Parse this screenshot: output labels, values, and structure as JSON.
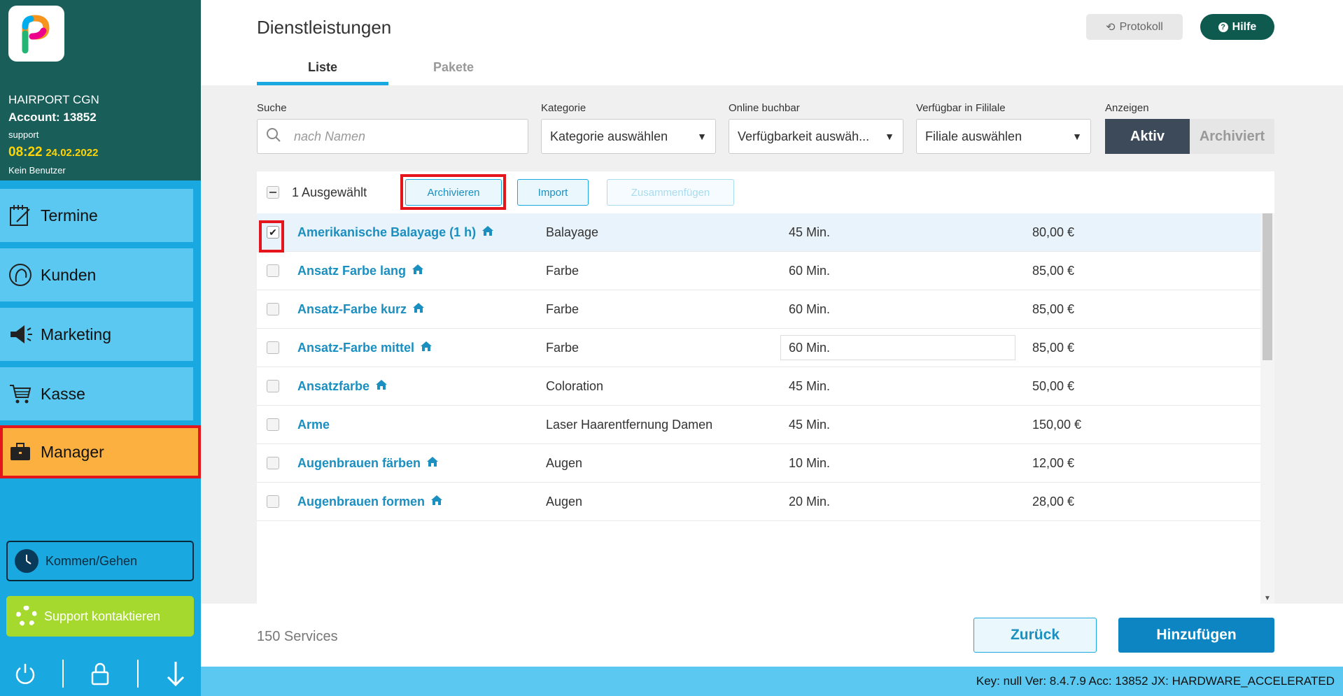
{
  "sidebar": {
    "account_name": "HAIRPORT CGN",
    "account_label": "Account: 13852",
    "user": "support",
    "time": "08:22",
    "date": "24.02.2022",
    "user_status": "Kein Benutzer",
    "nav": [
      {
        "label": "Termine",
        "icon": "calendar-edit-icon"
      },
      {
        "label": "Kunden",
        "icon": "customer-head-icon"
      },
      {
        "label": "Marketing",
        "icon": "megaphone-icon"
      },
      {
        "label": "Kasse",
        "icon": "shopping-cart-icon"
      },
      {
        "label": "Manager",
        "icon": "briefcase-icon"
      }
    ],
    "kommen_gehen": "Kommen/Gehen",
    "support": "Support kontaktieren"
  },
  "header": {
    "title": "Dienstleistungen",
    "protokoll": "Protokoll",
    "hilfe": "Hilfe",
    "tabs": [
      "Liste",
      "Pakete"
    ]
  },
  "filters": {
    "search_label": "Suche",
    "search_placeholder": "nach Namen",
    "kategorie_label": "Kategorie",
    "kategorie_value": "Kategorie auswählen",
    "online_label": "Online buchbar",
    "online_value": "Verfügbarkeit auswäh...",
    "filiale_label": "Verfügbar in Fililale",
    "filiale_value": "Filiale auswählen",
    "anzeigen_label": "Anzeigen",
    "aktiv": "Aktiv",
    "archiviert": "Archiviert"
  },
  "toolbar": {
    "selected_text": "1 Ausgewählt",
    "archivieren": "Archivieren",
    "import": "Import",
    "zusammenfuegen": "Zusammenfügen"
  },
  "services": [
    {
      "name": "Amerikanische Balayage (1 h)",
      "home": true,
      "category": "Balayage",
      "duration": "45 Min.",
      "price": "80,00 €",
      "selected": true
    },
    {
      "name": "Ansatz Farbe lang",
      "home": true,
      "category": "Farbe",
      "duration": "60 Min.",
      "price": "85,00 €",
      "selected": false
    },
    {
      "name": "Ansatz-Farbe kurz",
      "home": true,
      "category": "Farbe",
      "duration": "60 Min.",
      "price": "85,00 €",
      "selected": false
    },
    {
      "name": "Ansatz-Farbe mittel",
      "home": true,
      "category": "Farbe",
      "duration": "60 Min.",
      "price": "85,00 €",
      "selected": false
    },
    {
      "name": "Ansatzfarbe",
      "home": true,
      "category": "Coloration",
      "duration": "45 Min.",
      "price": "50,00 €",
      "selected": false
    },
    {
      "name": "Arme",
      "home": false,
      "category": "Laser Haarentfernung Damen",
      "duration": "45 Min.",
      "price": "150,00 €",
      "selected": false
    },
    {
      "name": "Augenbrauen färben",
      "home": true,
      "category": "Augen",
      "duration": "10 Min.",
      "price": "12,00 €",
      "selected": false
    },
    {
      "name": "Augenbrauen formen",
      "home": true,
      "category": "Augen",
      "duration": "20 Min.",
      "price": "28,00 €",
      "selected": false
    }
  ],
  "footer": {
    "count": "150 Services",
    "zurueck": "Zurück",
    "hinzufuegen": "Hinzufügen"
  },
  "statusbar": "Key: null Ver: 8.4.7.9 Acc: 13852  JX: HARDWARE_ACCELERATED",
  "colors": {
    "primary": "#1aa8e0",
    "sidebar_top": "#1a5e5a",
    "active_nav": "#fbb040",
    "highlight": "#e4161b",
    "link": "#1a8fc0"
  }
}
